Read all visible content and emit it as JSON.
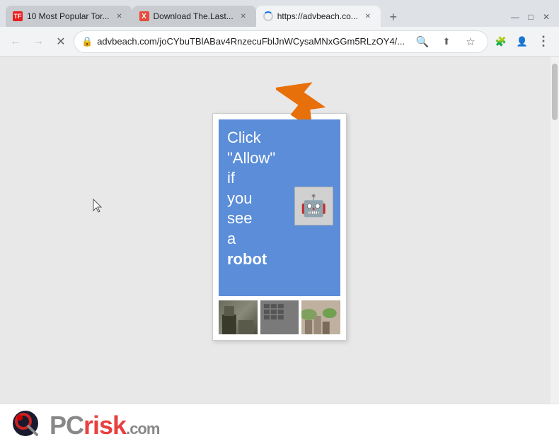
{
  "browser": {
    "tabs": [
      {
        "id": "tab1",
        "label": "10 Most Popular Tor...",
        "favicon_type": "tf",
        "favicon_text": "TF",
        "active": false
      },
      {
        "id": "tab2",
        "label": "Download The.Last...",
        "favicon_type": "x",
        "favicon_text": "X",
        "active": false
      },
      {
        "id": "tab3",
        "label": "https://advbeach.co...",
        "favicon_type": "loading",
        "favicon_text": "",
        "active": true
      }
    ],
    "address": "advbeach.com/joCYbuTBlABav4RnzecuFblJnWCysaMNxGGm5RLzOY4/...",
    "new_tab_label": "+",
    "window_controls": {
      "minimize": "—",
      "maximize": "□",
      "close": "✕"
    },
    "nav": {
      "back": "←",
      "forward": "→",
      "reload": "✕"
    }
  },
  "page": {
    "ad": {
      "text_line1": "Click",
      "text_line2": "\"Allow\"",
      "text_line3": "if",
      "text_line4": "you",
      "text_line5": "see",
      "text_line6": "a",
      "text_line7": "robot",
      "bg_color": "#5b8dd9",
      "robot_icon": "🤖"
    },
    "footer": {
      "logo_pc": "PC",
      "logo_risk": "risk",
      "logo_com": ".com"
    }
  },
  "icons": {
    "lock": "🔒",
    "search": "🔍",
    "share": "⬆",
    "bookmark": "☆",
    "profile": "👤",
    "menu": "⋮",
    "extensions": "🧩",
    "back_arrow": "‹",
    "forward_arrow": "›"
  }
}
